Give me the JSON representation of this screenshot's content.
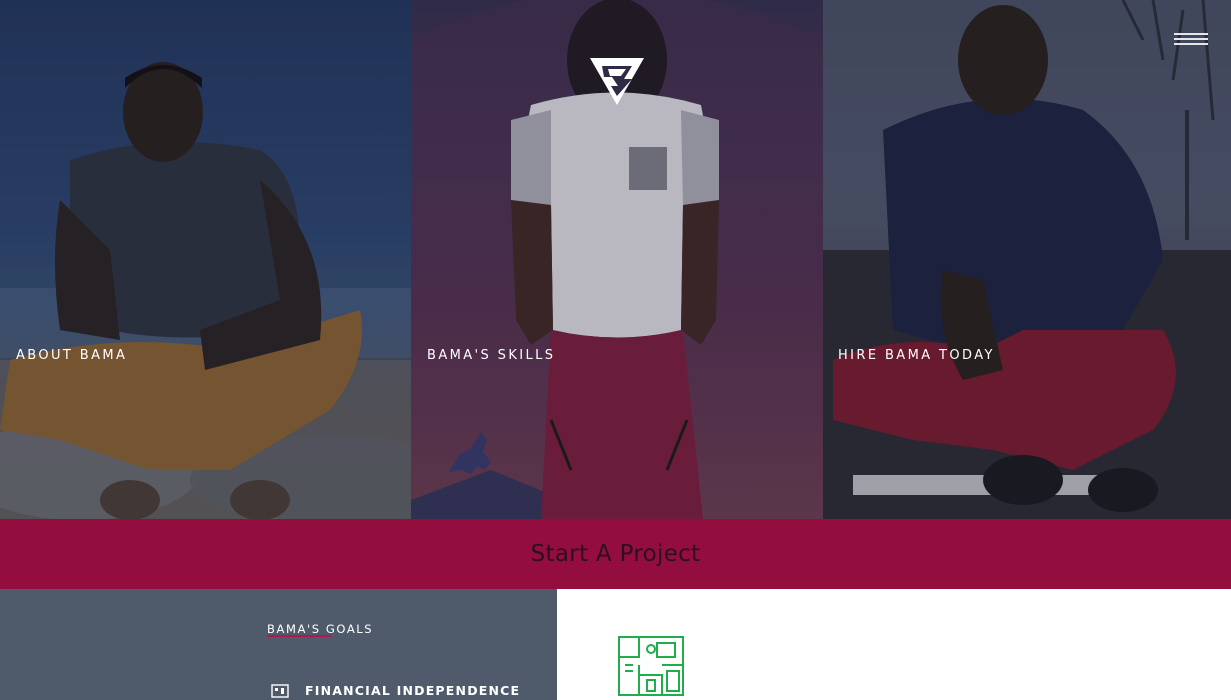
{
  "hero": {
    "panels": [
      {
        "label": "ABOUT BAMA"
      },
      {
        "label": "BAMA'S SKILLS"
      },
      {
        "label": "HIRE BAMA TODAY"
      }
    ],
    "logo_icon": "bama-logo-triangle",
    "menu_icon": "hamburger-menu-icon"
  },
  "cta": {
    "label": "Start A Project"
  },
  "goals": {
    "heading": "BAMA'S GOALS",
    "items": [
      {
        "label": "FINANCIAL INDEPENDENCE",
        "icon": "building-icon"
      }
    ]
  },
  "detail": {
    "icon": "floor-plan-icon"
  },
  "colors": {
    "accent": "#930d3e",
    "goals_bg": "#4f5b6b",
    "icon_green": "#1fae4b"
  }
}
